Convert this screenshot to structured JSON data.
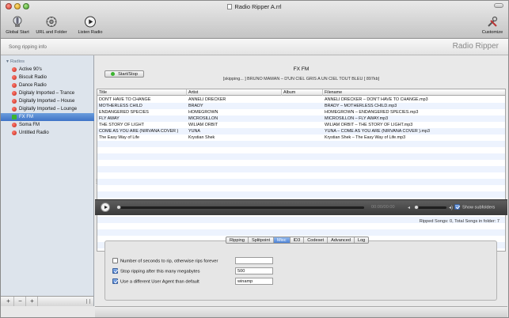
{
  "window": {
    "title": "Radio Ripper A.rrl"
  },
  "toolbar": {
    "global_start": "Global Start",
    "url_and_folder": "URL and Folder",
    "listen_radio": "Listen Radio",
    "customize": "Customize"
  },
  "subbar": {
    "song_info": "Song ripping info",
    "brand": "Radio Ripper"
  },
  "sidebar": {
    "header": "Radios",
    "items": [
      {
        "label": "Active 90's",
        "status": "stopped"
      },
      {
        "label": "Biscuit Radio",
        "status": "stopped"
      },
      {
        "label": "Dance Radio",
        "status": "stopped"
      },
      {
        "label": "Digitaly Imported – Trance",
        "status": "stopped"
      },
      {
        "label": "Digitally Imported – House",
        "status": "stopped"
      },
      {
        "label": "Digitally Imported – Lounge",
        "status": "stopped"
      },
      {
        "label": "FX FM",
        "status": "recording",
        "selected": true
      },
      {
        "label": "Soma FM",
        "status": "stopped"
      },
      {
        "label": "Untitled Radio",
        "status": "stopped"
      }
    ],
    "bottom_buttons": [
      "+",
      "−",
      "+"
    ]
  },
  "main": {
    "start_stop_label": "Start/Stop",
    "station_name": "FX FM",
    "now_playing": "[skipping...   ] BRUNO MAMAN – D'UN CIEL GRIS A UN CIEL TOUT BLEU [  897kb]",
    "columns": [
      "Title",
      "Artist",
      "Album",
      "Filename"
    ],
    "rows": [
      [
        "DON'T HAVE TO CHANGE",
        "ANNELI DRECKER",
        "",
        "ANNELI DRECKER – DON'T HAVE TO CHANGE.mp3"
      ],
      [
        "MOTHERLESS CHILD",
        "BRADY",
        "",
        "BRADY – MOTHERLESS CHILD.mp3"
      ],
      [
        "ENDANGERED SPECIES",
        "HOMEGROWN",
        "",
        "HOMEGROWN – ENDANGERED SPECIES.mp3"
      ],
      [
        "FLY AWAY",
        "MICROSILLON",
        "",
        "MICROSILLON – FLY AWAY.mp3"
      ],
      [
        "THE STORY OF LIGHT",
        "WILIAM ORBIT",
        "",
        "WILIAM ORBIT – THE STORY OF LIGHT.mp3"
      ],
      [
        "COME AS YOU ARE (NIRVANA COVER )",
        "YUNA",
        "",
        "YUNA – COME AS YOU ARE (NIRVANA COVER ).mp3"
      ],
      [
        "The Easy Way of Life",
        "Krystian Shek",
        "",
        "Krystian Shek – The Easy Way of Life.mp3"
      ]
    ],
    "player": {
      "time": "00:00/00:00",
      "show_subfolders": "Show subfolders",
      "show_subfolders_checked": true,
      "progress": 0,
      "volume": 0
    },
    "ripped_summary": "Ripped Songs: 0, Total Songs in folder: 7",
    "tabs": [
      "Ripping",
      "Splitpoint",
      "Misc",
      "ID3",
      "Codeset",
      "Advanced",
      "Log"
    ],
    "selected_tab": "Misc",
    "options": [
      {
        "label": "Number of seconds to rip, otherwise rips forever",
        "checked": false,
        "value": ""
      },
      {
        "label": "Stop ripping after this many megabytes",
        "checked": true,
        "value": "500"
      },
      {
        "label": "Use a different User Agent than default",
        "checked": true,
        "value": "winamp"
      }
    ]
  },
  "colors": {
    "selection": "#3f74c7",
    "record_green": "#3bb42f",
    "stop_red": "#c0271a",
    "row_alt": "#edf3fe"
  }
}
